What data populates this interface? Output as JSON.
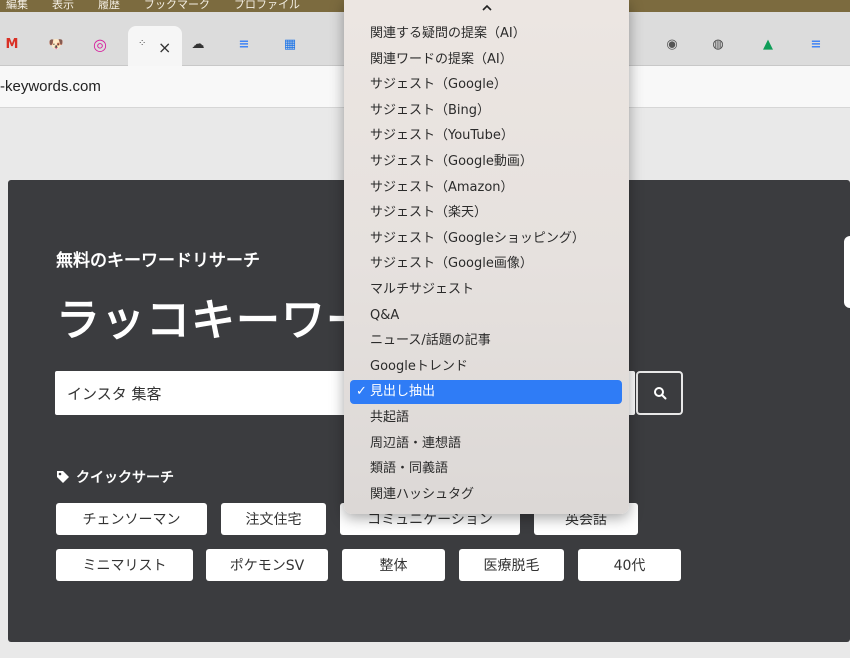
{
  "menubar": {
    "items": [
      "編集",
      "表示",
      "履歴",
      "ブックマーク",
      "プロファイル"
    ]
  },
  "tabs": [
    {
      "icon": "gmail-icon",
      "glyph": "M",
      "color": "#d93025"
    },
    {
      "icon": "dog-icon",
      "glyph": "🐶",
      "color": "#7a5a3a"
    },
    {
      "icon": "instagram-icon",
      "glyph": "◎",
      "color": "#d6249f"
    },
    {
      "icon": "cloud-icon",
      "glyph": "☁",
      "color": "#111"
    },
    {
      "icon": "docs-icon",
      "glyph": "≡",
      "color": "#4285f4"
    },
    {
      "icon": "grid-icon",
      "glyph": "▦",
      "color": "#1a73e8"
    },
    {
      "icon": "chrome-icon",
      "glyph": "◉",
      "color": "#555"
    },
    {
      "icon": "drive-icon",
      "glyph": "▲",
      "color": "#0f9d58"
    },
    {
      "icon": "docs2-icon",
      "glyph": "≡",
      "color": "#4285f4"
    }
  ],
  "active_tab": {
    "close_glyph": "×"
  },
  "address": {
    "url": "-keywords.com"
  },
  "hero": {
    "subtitle": "無料のキーワードリサーチ",
    "title": "ラッコキーワード",
    "search_value": "インスタ 集客",
    "quick_search_label": "クイックサーチ",
    "chips": [
      "チェンソーマン",
      "注文住宅",
      "コミュニケーション",
      "英会話",
      "ミニマリスト",
      "ポケモンSV",
      "整体",
      "医療脱毛",
      "40代"
    ]
  },
  "dropdown": {
    "items": [
      "関連する疑問の提案（AI）",
      "関連ワードの提案（AI）",
      "サジェスト（Google）",
      "サジェスト（Bing）",
      "サジェスト（YouTube）",
      "サジェスト（Google動画）",
      "サジェスト（Amazon）",
      "サジェスト（楽天）",
      "サジェスト（Googleショッピング）",
      "サジェスト（Google画像）",
      "マルチサジェスト",
      "Q&A",
      "ニュース/話題の記事",
      "Googleトレンド",
      "見出し抽出",
      "共起語",
      "周辺語・連想語",
      "類語・同義語",
      "関連ハッシュタグ"
    ],
    "selected": "見出し抽出",
    "check_glyph": "✓"
  }
}
